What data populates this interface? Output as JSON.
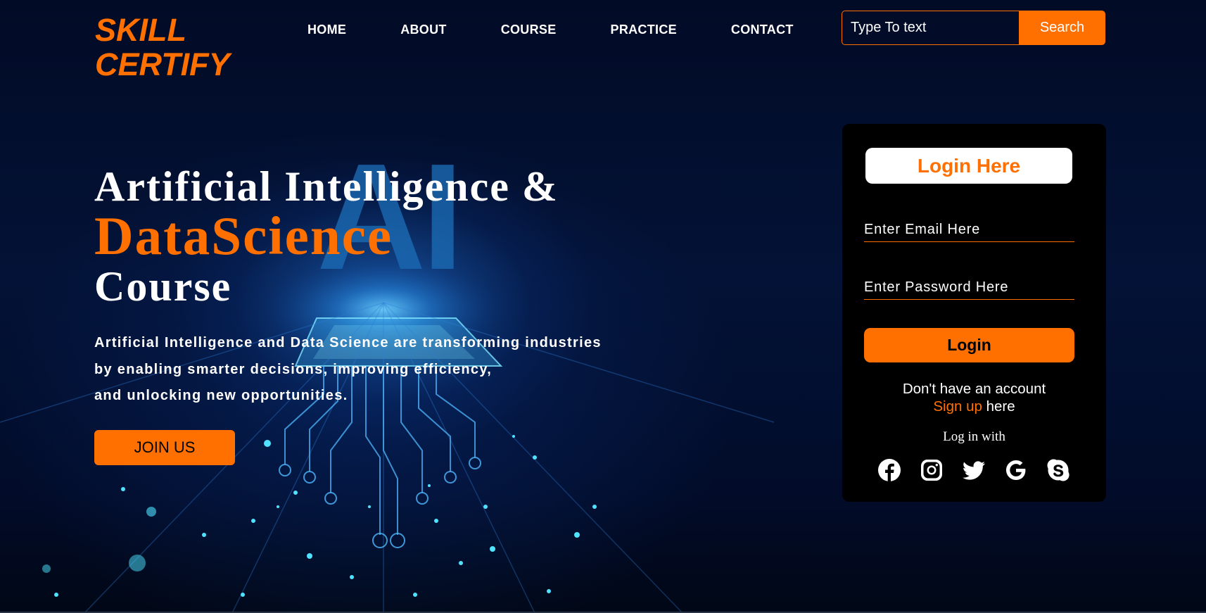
{
  "brand": {
    "logo_line1": "SKILL",
    "logo_line2": "CERTIFY",
    "accent_color": "#ff7000",
    "background_color": "#01081f"
  },
  "nav": {
    "items": [
      {
        "label": "HOME"
      },
      {
        "label": "ABOUT"
      },
      {
        "label": "COURSE"
      },
      {
        "label": "PRACTICE"
      },
      {
        "label": "CONTACT"
      }
    ]
  },
  "search": {
    "placeholder": "Type To text",
    "button_label": "Search"
  },
  "hero": {
    "title_line1": "Artificial Intelligence &",
    "title_line2": "DataScience",
    "title_line3": "Course",
    "desc_line1": "Artificial Intelligence and Data Science are transforming industries",
    "desc_line2": "by enabling smarter decisions, improving efficiency,",
    "desc_line3": "and unlocking new opportunities.",
    "cta_label": "JOIN US",
    "background_graphic_text": "AI"
  },
  "login": {
    "header": "Login Here",
    "email_placeholder": "Enter Email Here",
    "password_placeholder": "Enter Password Here",
    "button_label": "Login",
    "no_account_text": "Don't have an account",
    "signup_link": "Sign up",
    "signup_suffix": "here",
    "login_with": "Log in with",
    "social_icons": [
      "facebook-icon",
      "instagram-icon",
      "twitter-icon",
      "google-icon",
      "skype-icon"
    ]
  }
}
